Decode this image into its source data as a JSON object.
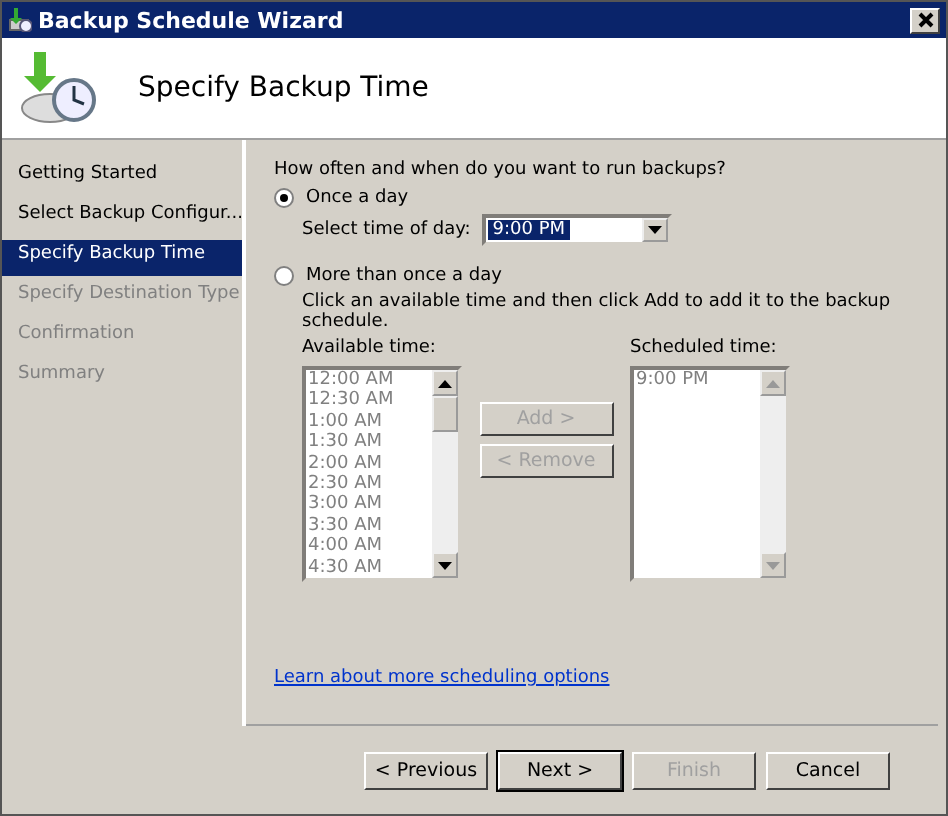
{
  "window": {
    "title": "Backup Schedule Wizard"
  },
  "header": {
    "title": "Specify Backup Time"
  },
  "sidebar": {
    "items": [
      {
        "label": "Getting Started",
        "selected": false,
        "disabled": false
      },
      {
        "label": "Select Backup Configur...",
        "selected": false,
        "disabled": false
      },
      {
        "label": "Specify Backup Time",
        "selected": true,
        "disabled": false
      },
      {
        "label": "Specify Destination Type",
        "selected": false,
        "disabled": true
      },
      {
        "label": "Confirmation",
        "selected": false,
        "disabled": true
      },
      {
        "label": "Summary",
        "selected": false,
        "disabled": true
      }
    ]
  },
  "content": {
    "question": "How often and when do you want to run backups?",
    "options": [
      {
        "label": "Once a day",
        "selected": true
      },
      {
        "label": "More than once a day",
        "selected": false
      }
    ],
    "time_of_day": {
      "label": "Select time of day:",
      "value": "9:00 PM"
    },
    "instruction": "Click an available time and then click Add to add it to the backup schedule.",
    "available": {
      "label": "Available time:",
      "items": [
        "12:00 AM",
        "12:30 AM",
        "1:00 AM",
        "1:30 AM",
        "2:00 AM",
        "2:30 AM",
        "3:00 AM",
        "3:30 AM",
        "4:00 AM",
        "4:30 AM"
      ]
    },
    "move_buttons": [
      {
        "label": "Add >",
        "disabled": true
      },
      {
        "label": "< Remove",
        "disabled": true
      }
    ],
    "scheduled": {
      "label": "Scheduled time:",
      "items": [
        "9:00 PM"
      ]
    },
    "link": "Learn about more scheduling options"
  },
  "buttons": [
    {
      "label": "< Previous",
      "disabled": false,
      "default": false
    },
    {
      "label": "Next >",
      "disabled": false,
      "default": true
    },
    {
      "label": "Finish",
      "disabled": true,
      "default": false
    },
    {
      "label": "Cancel",
      "disabled": false,
      "default": false
    }
  ]
}
